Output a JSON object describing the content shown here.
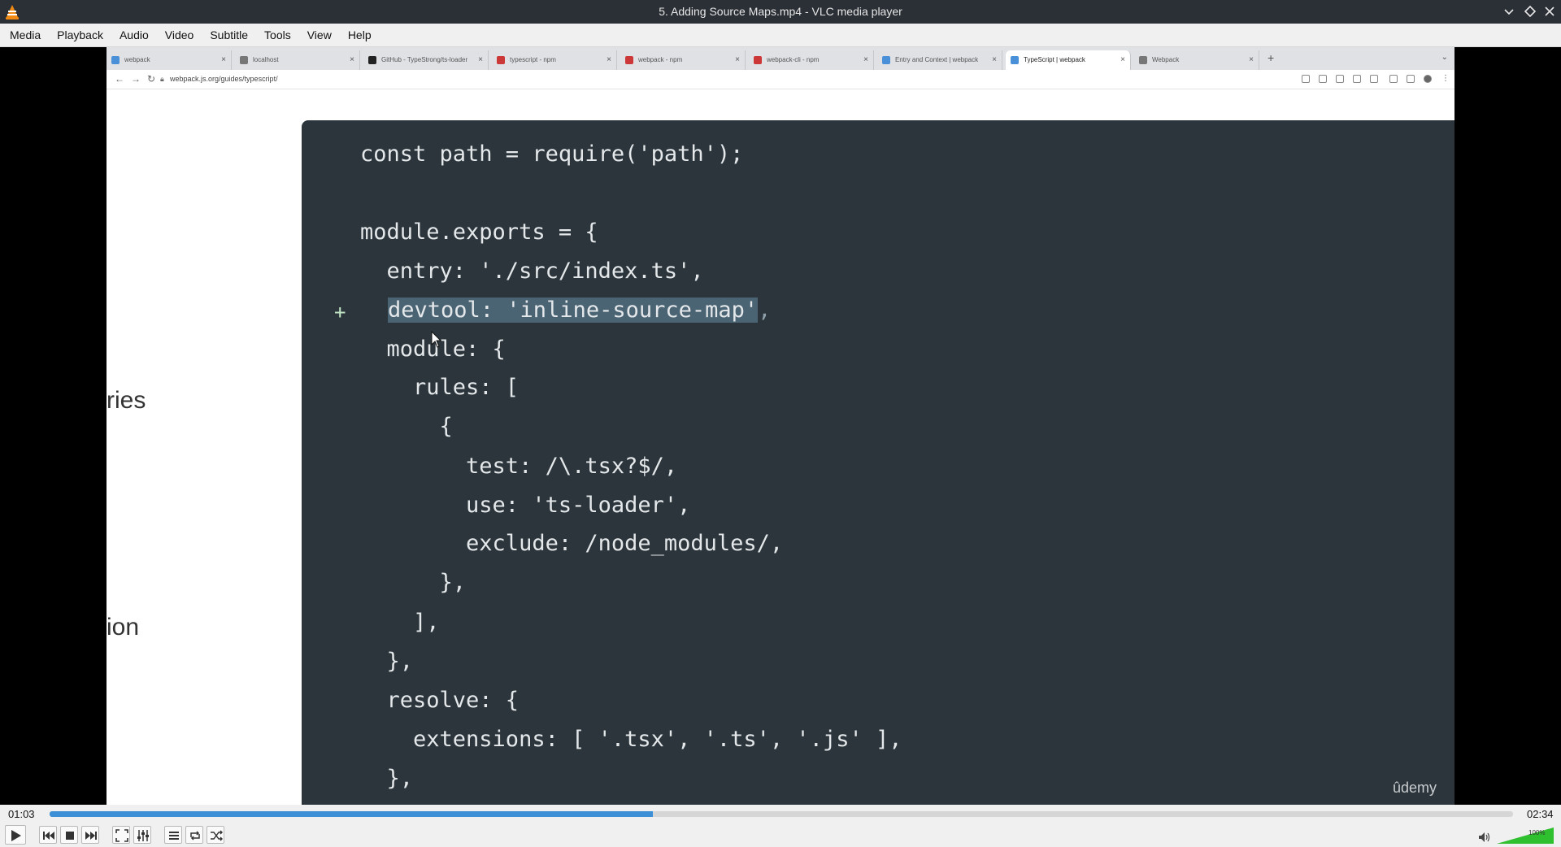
{
  "window": {
    "title": "5. Adding Source Maps.mp4 - VLC media player"
  },
  "menubar": {
    "items": [
      "Media",
      "Playback",
      "Audio",
      "Video",
      "Subtitle",
      "Tools",
      "View",
      "Help"
    ]
  },
  "browser": {
    "tabs": [
      {
        "label": "webpack",
        "color": "#4a90d9"
      },
      {
        "label": "localhost",
        "color": "#777777"
      },
      {
        "label": "GitHub - TypeStrong/ts-loader",
        "color": "#222222"
      },
      {
        "label": "typescript - npm",
        "color": "#cb3837"
      },
      {
        "label": "webpack - npm",
        "color": "#cb3837"
      },
      {
        "label": "webpack-cli - npm",
        "color": "#cb3837"
      },
      {
        "label": "Entry and Context | webpack",
        "color": "#4a90d9"
      },
      {
        "label": "TypeScript | webpack",
        "color": "#4a90d9"
      },
      {
        "label": "Webpack",
        "color": "#777777"
      }
    ],
    "active_tab": 7,
    "url": "webpack.js.org/guides/typescript/"
  },
  "page_side": {
    "text_1": "ries",
    "text_2": "ion"
  },
  "code": {
    "lines": [
      "const path = require('path');",
      "",
      "module.exports = {",
      "  entry: './src/index.ts',",
      "  devtool: 'inline-source-map',",
      "  module: {",
      "    rules: [",
      "      {",
      "        test: /\\.tsx?$/,",
      "        use: 'ts-loader',",
      "        exclude: /node_modules/,",
      "      },",
      "    ],",
      "  },",
      "  resolve: {",
      "    extensions: [ '.tsx', '.ts', '.js' ],",
      "  },"
    ],
    "added_marker": "+",
    "highlight_text": "devtool: 'inline-source-map'",
    "highlight_suffix": ",",
    "watermark": "ûdemy"
  },
  "playback": {
    "current_time": "01:03",
    "total_time": "02:34",
    "progress": 0.412,
    "volume_label": "100%",
    "volume": 1.0
  },
  "colors": {
    "accent": "#3d8fd6",
    "code_bg": "#2b353b",
    "highlight": "#4b6474"
  }
}
